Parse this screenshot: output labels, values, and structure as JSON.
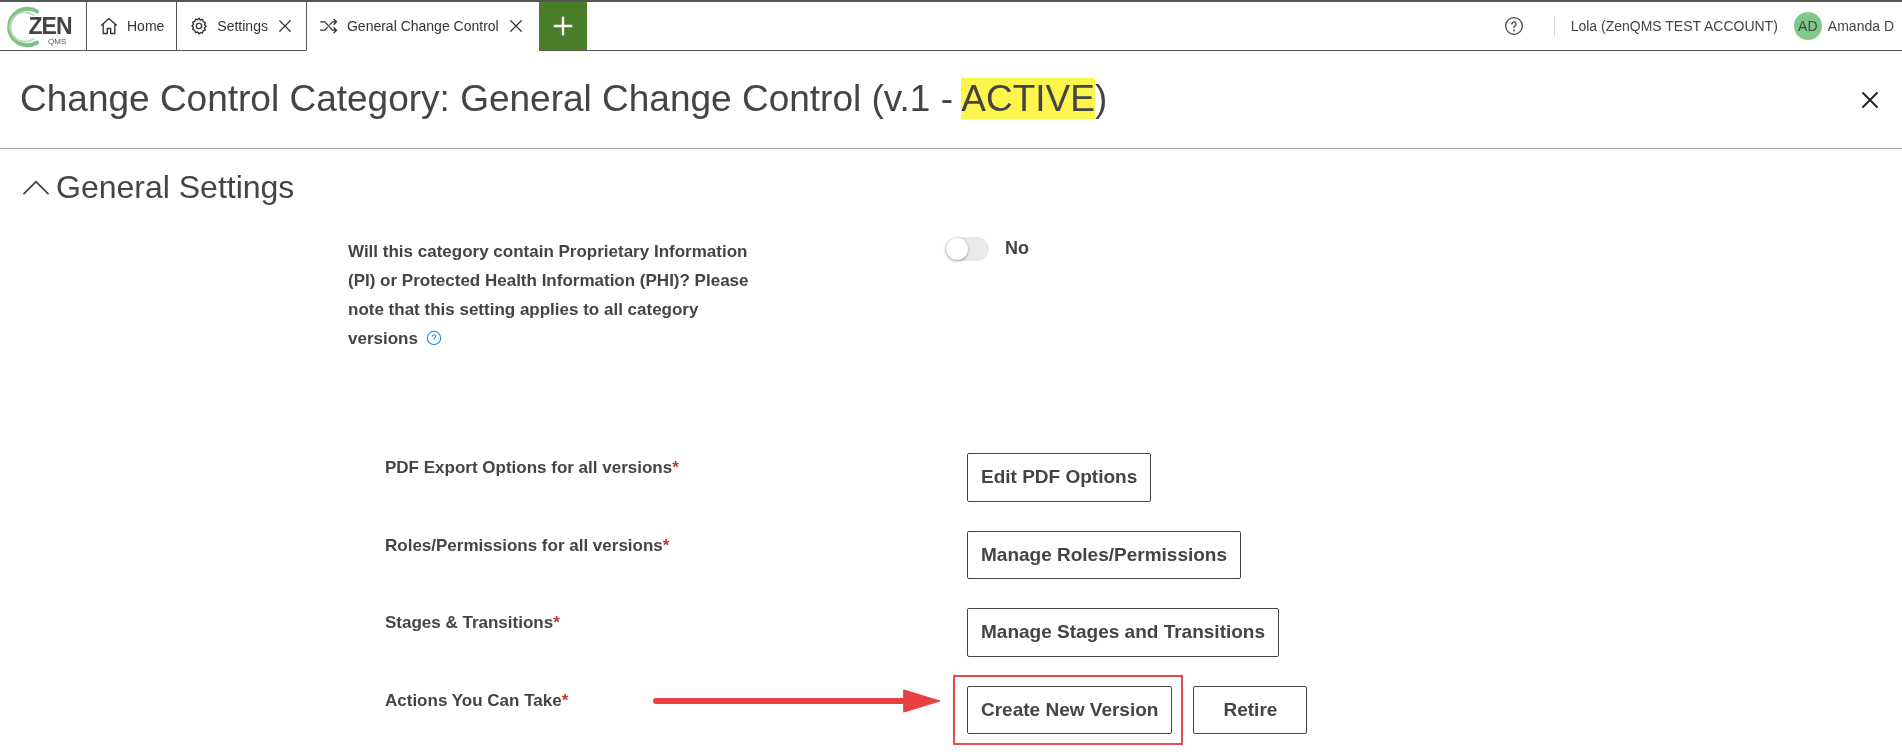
{
  "logo": {
    "text": "ZEN",
    "subtext": "QMS"
  },
  "tabs": [
    {
      "label": "Home",
      "kind": "home",
      "closable": false,
      "selected": false
    },
    {
      "label": "Settings",
      "kind": "settings",
      "closable": true,
      "selected": false
    },
    {
      "label": "General Change Control",
      "kind": "workflow",
      "closable": true,
      "selected": true
    }
  ],
  "user": {
    "account": "Lola (ZenQMS TEST ACCOUNT)",
    "initials": "AD",
    "name": "Amanda D"
  },
  "page_title": {
    "prefix": "Change Control Category: General Change Control (v.1 - ",
    "status": "ACTIVE",
    "suffix": ")"
  },
  "section": {
    "title": "General Settings",
    "expanded": true
  },
  "question": {
    "text": "Will this category contain Proprietary Information (PI) or Protected Health Information (PHI)? Please note that this setting applies to all category versions",
    "toggle_on": false,
    "toggle_label": "No"
  },
  "settings": [
    {
      "label": "PDF Export Options for all versions",
      "required_mark": "*",
      "pointer": false,
      "buttons": [
        {
          "label": "Edit PDF Options",
          "highlighted": false
        }
      ]
    },
    {
      "label": "Roles/Permissions for all versions",
      "required_mark": "*",
      "pointer": false,
      "buttons": [
        {
          "label": "Manage Roles/Permissions",
          "highlighted": false
        }
      ]
    },
    {
      "label": "Stages & Transitions",
      "required_mark": "*",
      "pointer": false,
      "buttons": [
        {
          "label": "Manage Stages and Transitions",
          "highlighted": false
        }
      ]
    },
    {
      "label": "Actions You Can Take",
      "required_mark": "*",
      "pointer": true,
      "buttons": [
        {
          "label": "Create New Version",
          "highlighted": true
        },
        {
          "label": "Retire",
          "highlighted": false
        }
      ]
    }
  ]
}
